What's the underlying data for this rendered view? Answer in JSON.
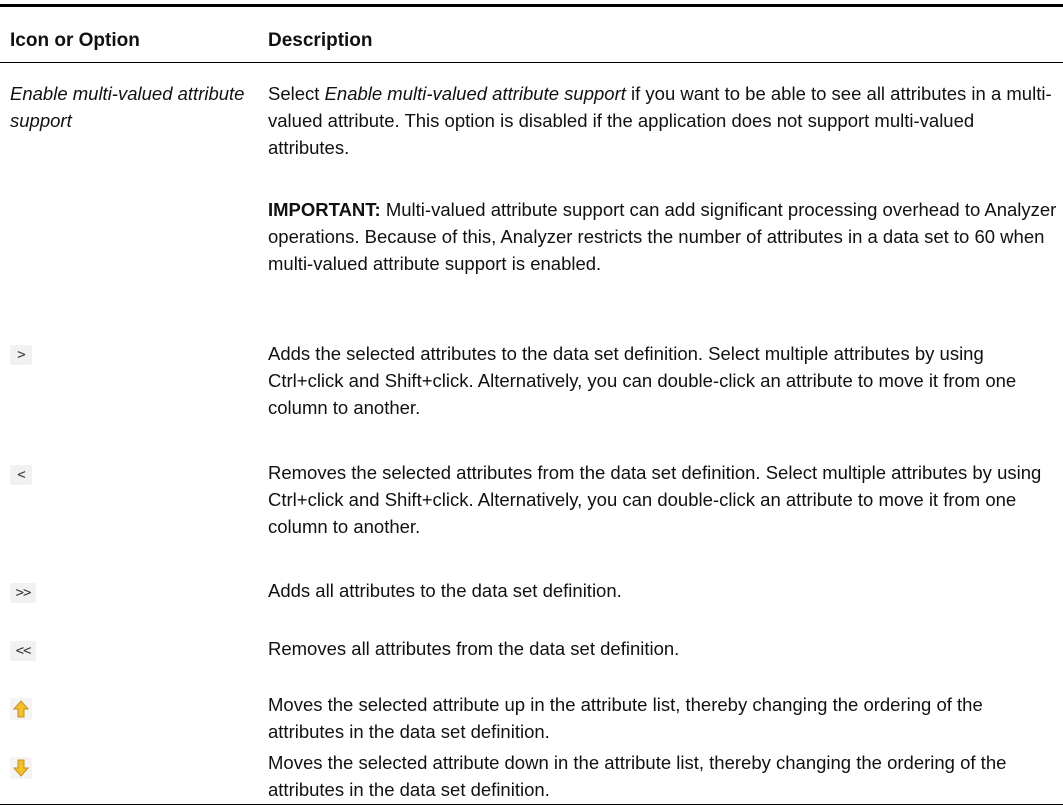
{
  "table": {
    "headers": {
      "col1": "Icon or Option",
      "col2": "Description"
    },
    "rows": [
      {
        "option": "Enable multi-valued attribute support",
        "desc_pre": "Select ",
        "desc_em": "Enable multi-valued attribute support",
        "desc_post": " if you want to be able to see all attributes in a multi-valued attribute. This option is disabled if the application does not support multi-valued attributes."
      },
      {
        "note_label": "IMPORTANT:",
        "note_text": " Multi-valued attribute support can add significant processing overhead to Analyzer operations. Because of this, Analyzer restricts the number of attributes in a data set to 60 when multi-valued attribute support is enabled."
      },
      {
        "icon": "add-selected-icon",
        "glyph": ">",
        "desc": "Adds the selected attributes to the data set definition. Select multiple attributes by using Ctrl+click and Shift+click. Alternatively, you can double-click an attribute to move it from one column to another."
      },
      {
        "icon": "remove-selected-icon",
        "glyph": "<",
        "desc": "Removes the selected attributes from the data set definition. Select multiple attributes by using Ctrl+click and Shift+click. Alternatively, you can double-click an attribute to move it from one column to another."
      },
      {
        "icon": "add-all-icon",
        "glyph": ">>",
        "desc": "Adds all attributes to the data set definition."
      },
      {
        "icon": "remove-all-icon",
        "glyph": "<<",
        "desc": "Removes all attributes from the data set definition."
      },
      {
        "icon": "move-up-icon",
        "desc": "Moves the selected attribute up in the attribute list, thereby changing the ordering of the attributes in the data set definition."
      },
      {
        "icon": "move-down-icon",
        "desc": "Moves the selected attribute down in the attribute list, thereby changing the ordering of the attributes in the data set definition."
      }
    ],
    "colors": {
      "arrow_fill": "#f2c12e",
      "arrow_stroke": "#c8901a",
      "button_bg": "#f1f1f1"
    }
  }
}
